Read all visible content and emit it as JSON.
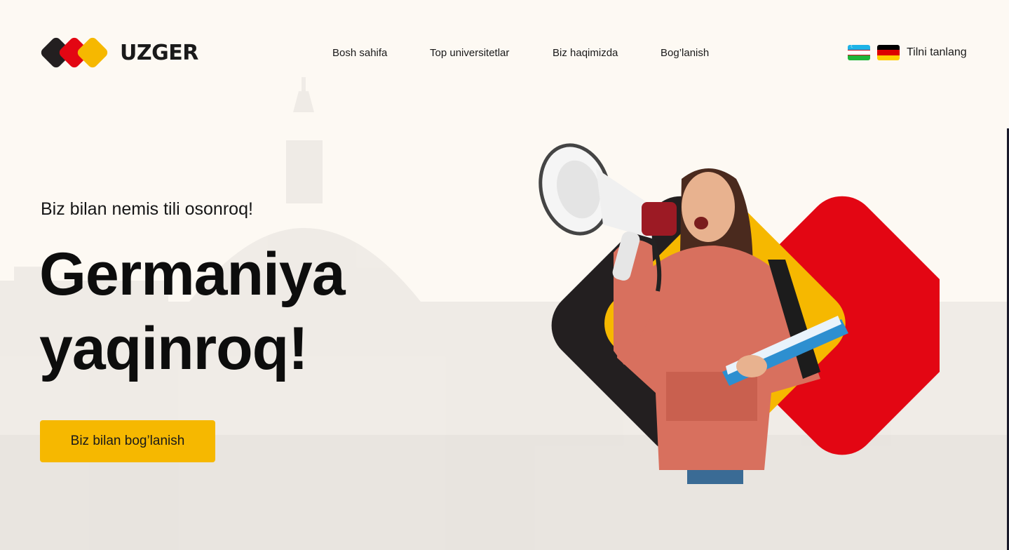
{
  "brand": {
    "name": "UZGER",
    "colors": {
      "black": "#231f20",
      "red": "#e30613",
      "yellow": "#f6b800"
    }
  },
  "nav": {
    "items": [
      {
        "label": "Bosh sahifa"
      },
      {
        "label": "Top universitetlar"
      },
      {
        "label": "Biz haqimizda"
      },
      {
        "label": "Bog’lanish"
      }
    ]
  },
  "language": {
    "label": "Tilni tanlang",
    "flags": [
      {
        "name": "uzbekistan-flag-icon"
      },
      {
        "name": "germany-flag-icon"
      }
    ]
  },
  "hero": {
    "subtitle": "Biz bilan nemis tili osonroq!",
    "title_line1": "Germaniya",
    "title_line2": "yaqinroq!",
    "cta_label": "Biz bilan bog’lanish"
  },
  "colors": {
    "background": "#fdf9f3",
    "accent": "#f6b800"
  }
}
